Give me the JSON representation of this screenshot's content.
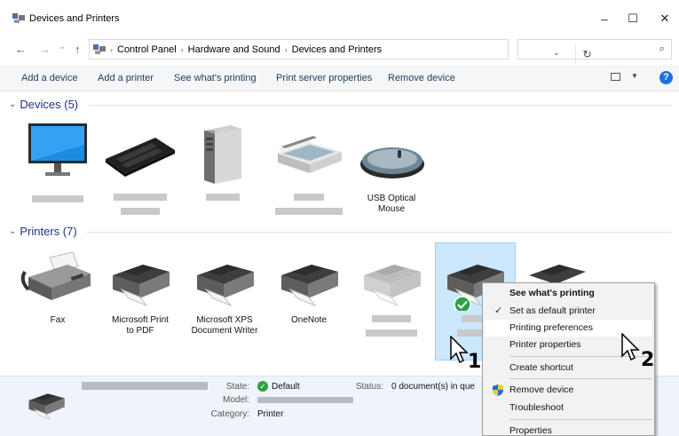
{
  "window": {
    "title": "Devices and Printers",
    "minimize": "–",
    "maximize": "☐",
    "close": "✕"
  },
  "nav": {
    "back": "←",
    "forward": "→",
    "history": "⌄",
    "up": "↑"
  },
  "address": {
    "crumbs": [
      "Control Panel",
      "Hardware and Sound",
      "Devices and Printers"
    ],
    "separator": "›",
    "dropdown": "⌄",
    "refresh": "↻"
  },
  "search": {
    "placeholder": "",
    "icon": "⌕"
  },
  "commands": [
    "Add a device",
    "Add a printer",
    "See what's printing",
    "Print server properties",
    "Remove device"
  ],
  "help_label": "?",
  "groups": {
    "devices": "Devices (5)",
    "printers": "Printers (7)",
    "chevron": "⌄"
  },
  "devices": [
    {
      "icon": "monitor-icon",
      "label": ""
    },
    {
      "icon": "keyboard-icon",
      "label": ""
    },
    {
      "icon": "computer-tower-icon",
      "label": ""
    },
    {
      "icon": "scanner-icon",
      "label": ""
    },
    {
      "icon": "mouse-icon",
      "label": "USB Optical Mouse",
      "label_line1": "USB Optical",
      "label_line2": "Mouse"
    }
  ],
  "printers": [
    {
      "icon": "fax-icon",
      "label_line1": "Fax",
      "label_line2": ""
    },
    {
      "icon": "printer-icon",
      "label_line1": "Microsoft Print",
      "label_line2": "to PDF"
    },
    {
      "icon": "printer-icon",
      "label_line1": "Microsoft XPS",
      "label_line2": "Document Writer"
    },
    {
      "icon": "printer-icon",
      "label_line1": "OneNote",
      "label_line2": ""
    },
    {
      "icon": "printer-icon",
      "label_line1": "",
      "label_line2": ""
    },
    {
      "icon": "printer-icon",
      "label_line1": "",
      "label_line2": "",
      "default": true,
      "selected": true
    },
    {
      "icon": "printer-icon",
      "label_line1": "",
      "label_line2": ""
    }
  ],
  "details": {
    "state_label": "State:",
    "state_value": "Default",
    "model_label": "Model:",
    "category_label": "Category:",
    "category_value": "Printer",
    "status_label": "Status:",
    "status_value": "0 document(s) in que"
  },
  "context_menu": {
    "items": [
      {
        "label": "See what's printing",
        "bold": true
      },
      {
        "label": "Set as default printer",
        "checked": true
      },
      {
        "label": "Printing preferences",
        "hover": true
      },
      {
        "label": "Printer properties"
      },
      {
        "label": "Create shortcut"
      },
      {
        "label": "Remove device",
        "icon": "shield-icon"
      },
      {
        "label": "Troubleshoot"
      },
      {
        "label": "Properties"
      }
    ],
    "check_glyph": "✓"
  },
  "callouts": [
    "1",
    "2"
  ],
  "colors": {
    "accent": "#1a73d9",
    "selection": "#cce8ff",
    "default_badge": "#2ea043",
    "details_bg": "#eff4fb"
  }
}
